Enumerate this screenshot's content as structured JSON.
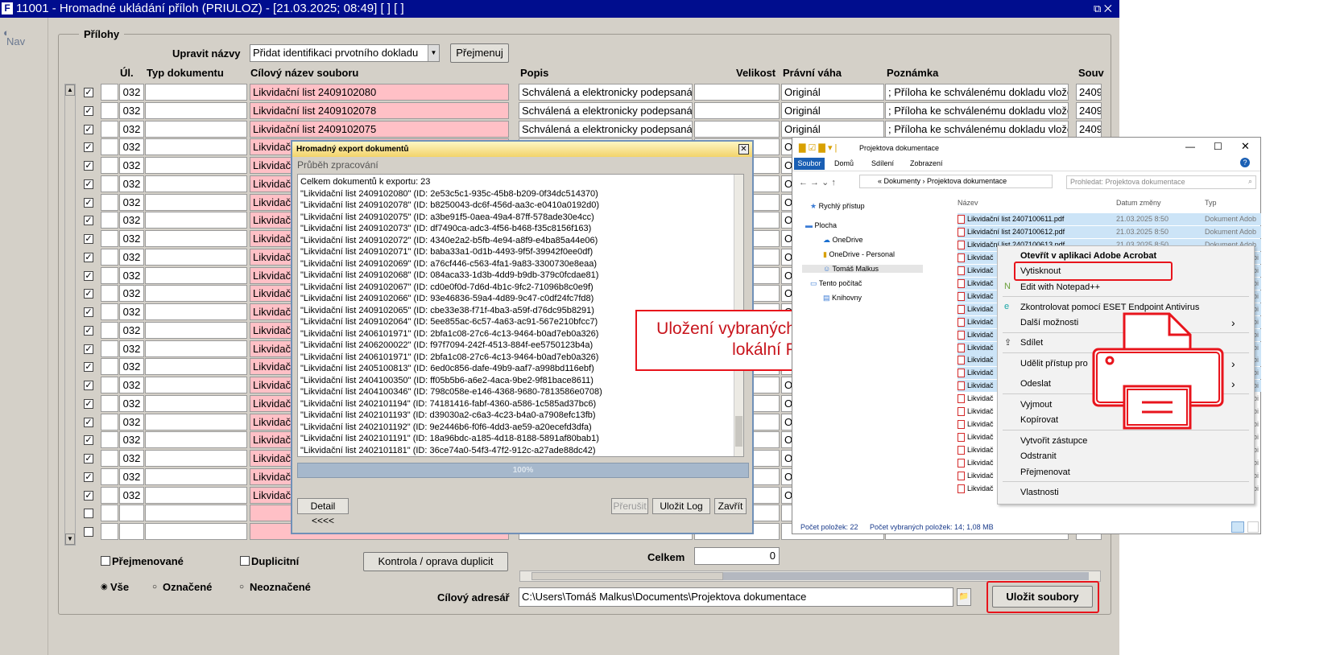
{
  "window": {
    "title": "11001 - Hromadné ukládání příloh (PRIULOZ) - [21.03.2025; 08:49]  [ ]  [ ]",
    "controls": "⧉ ✕"
  },
  "nav": {
    "label": "Nav"
  },
  "prilohy": {
    "legend": "Přílohy",
    "rename_label": "Upravit názvy",
    "rename_value": "Přidat identifikaci prvotního dokladu",
    "rename_button": "Přejmenuj",
    "columns": [
      "Úl.",
      "Typ dokumentu",
      "Cílový název souboru",
      "Popis",
      "Velikost",
      "Právní váha",
      "Poznámka",
      "Souv"
    ],
    "rows": [
      {
        "checked": true,
        "ul": "032",
        "name": "Likvidační list 2409102080",
        "popis": "Schválená a elektronicky podepsaná l",
        "vaha": "Originál",
        "pozn": "; Příloha ke schválenému dokladu vlože",
        "souv": "2409"
      },
      {
        "checked": true,
        "ul": "032",
        "name": "Likvidační list 2409102078",
        "popis": "Schválená a elektronicky podepsaná l",
        "vaha": "Originál",
        "pozn": "; Příloha ke schválenému dokladu vlože",
        "souv": "2409"
      },
      {
        "checked": true,
        "ul": "032",
        "name": "Likvidační list 2409102075",
        "popis": "Schválená a elektronicky podepsaná l",
        "vaha": "Originál",
        "pozn": "; Příloha ke schválenému dokladu vlože",
        "souv": "2409"
      },
      {
        "checked": true,
        "ul": "032",
        "name": "Likvidačn",
        "popis": "",
        "vaha": "O",
        "pozn": "",
        "souv": ""
      },
      {
        "checked": true,
        "ul": "032",
        "name": "Likvidačn",
        "popis": "",
        "vaha": "O",
        "pozn": "",
        "souv": ""
      },
      {
        "checked": true,
        "ul": "032",
        "name": "Likvidačn",
        "popis": "",
        "vaha": "O",
        "pozn": "",
        "souv": ""
      },
      {
        "checked": true,
        "ul": "032",
        "name": "Likvidačn",
        "popis": "",
        "vaha": "O",
        "pozn": "",
        "souv": ""
      },
      {
        "checked": true,
        "ul": "032",
        "name": "Likvidačn",
        "popis": "",
        "vaha": "O",
        "pozn": "",
        "souv": ""
      },
      {
        "checked": true,
        "ul": "032",
        "name": "Likvidačn",
        "popis": "",
        "vaha": "O",
        "pozn": "",
        "souv": ""
      },
      {
        "checked": true,
        "ul": "032",
        "name": "Likvidačn",
        "popis": "",
        "vaha": "O",
        "pozn": "",
        "souv": ""
      },
      {
        "checked": true,
        "ul": "032",
        "name": "Likvidačn",
        "popis": "",
        "vaha": "O",
        "pozn": "",
        "souv": ""
      },
      {
        "checked": true,
        "ul": "032",
        "name": "Likvidačn",
        "popis": "",
        "vaha": "O",
        "pozn": "",
        "souv": ""
      },
      {
        "checked": true,
        "ul": "032",
        "name": "Likvidačn",
        "popis": "",
        "vaha": "O",
        "pozn": "",
        "souv": ""
      },
      {
        "checked": true,
        "ul": "032",
        "name": "Likvidačn",
        "popis": "",
        "vaha": "O",
        "pozn": "",
        "souv": ""
      },
      {
        "checked": true,
        "ul": "032",
        "name": "Likvidačn",
        "popis": "",
        "vaha": "O",
        "pozn": "",
        "souv": ""
      },
      {
        "checked": true,
        "ul": "032",
        "name": "Likvidačn",
        "popis": "",
        "vaha": "O",
        "pozn": "",
        "souv": ""
      },
      {
        "checked": true,
        "ul": "032",
        "name": "Likvidačn",
        "popis": "",
        "vaha": "O",
        "pozn": "",
        "souv": ""
      },
      {
        "checked": true,
        "ul": "032",
        "name": "Likvidačn",
        "popis": "",
        "vaha": "O",
        "pozn": "",
        "souv": ""
      },
      {
        "checked": true,
        "ul": "032",
        "name": "Likvidačn",
        "popis": "",
        "vaha": "O",
        "pozn": "",
        "souv": ""
      },
      {
        "checked": true,
        "ul": "032",
        "name": "Likvidačn",
        "popis": "",
        "vaha": "O",
        "pozn": "",
        "souv": ""
      },
      {
        "checked": true,
        "ul": "032",
        "name": "Likvidačn",
        "popis": "",
        "vaha": "O",
        "pozn": "",
        "souv": ""
      },
      {
        "checked": true,
        "ul": "032",
        "name": "Likvidačn",
        "popis": "",
        "vaha": "O",
        "pozn": "",
        "souv": ""
      },
      {
        "checked": true,
        "ul": "032",
        "name": "Likvidačn",
        "popis": "",
        "vaha": "O",
        "pozn": "",
        "souv": ""
      },
      {
        "checked": false,
        "ul": "",
        "name": "",
        "popis": "",
        "vaha": "",
        "pozn": "",
        "souv": ""
      },
      {
        "checked": false,
        "ul": "",
        "name": "",
        "popis": "",
        "vaha": "",
        "pozn": "",
        "souv": ""
      }
    ],
    "filters": {
      "renamed": "Přejmenované",
      "duplicate": "Duplicitní",
      "check_button": "Kontrola / oprava duplicit",
      "all": "Vše",
      "marked": "Označené",
      "unmarked": "Neoznačené"
    },
    "total_label": "Celkem",
    "total_value": "0",
    "target_label": "Cílový adresář",
    "target_value": "C:\\Users\\Tomáš Malkus\\Documents\\Projektova dokumentace",
    "save_button": "Uložit soubory"
  },
  "dialog": {
    "title": "Hromadný export dokumentů",
    "subtitle": "Průběh zpracování",
    "close": "✕",
    "log": [
      "Celkem dokumentů k exportu: 23",
      "\"Likvidační list 2409102080\" (ID: 2e53c5c1-935c-45b8-b209-0f34dc514370)",
      "\"Likvidační list 2409102078\" (ID: b8250043-dc6f-456d-aa3c-e0410a0192d0)",
      "\"Likvidační list 2409102075\" (ID: a3be91f5-0aea-49a4-87ff-578ade30e4cc)",
      "\"Likvidační list 2409102073\" (ID: df7490ca-adc3-4f56-b468-f35c8156f163)",
      "\"Likvidační list 2409102072\" (ID: 4340e2a2-b5fb-4e94-a8f9-e4ba85a44e06)",
      "\"Likvidační list 2409102071\" (ID: baba33a1-0d1b-4493-9f5f-39942f0ee0df)",
      "\"Likvidační list 2409102069\" (ID: a76cf446-c563-4fa1-9a83-3300730e8eaa)",
      "\"Likvidační list 2409102068\" (ID: 084aca33-1d3b-4dd9-b9db-379c0fcdae81)",
      "\"Likvidační list 2409102067\" (ID: cd0e0f0d-7d6d-4b1c-9fc2-71096b8c0e9f)",
      "\"Likvidační list 2409102066\" (ID: 93e46836-59a4-4d89-9c47-c0df24fc7fd8)",
      "\"Likvidační list 2409102065\" (ID: cbe33e38-f71f-4ba3-a59f-d76dc95b8291)",
      "\"Likvidační list 2409102064\" (ID: 5ee855ac-6c57-4a63-ac91-567e210bfcc7)",
      "\"Likvidační list 2406101971\" (ID: 2bfa1c08-27c6-4c13-9464-b0ad7eb0a326)",
      "\"Likvidační list 2406200022\" (ID: f97f7094-242f-4513-884f-ee5750123b4a)",
      "\"Likvidační list 2406101971\" (ID: 2bfa1c08-27c6-4c13-9464-b0ad7eb0a326)",
      "\"Likvidační list 2405100813\" (ID: 6ed0c856-dafe-49b9-aaf7-a998bd116ebf)",
      "\"Likvidační list 2404100350\" (ID: ff05b5b6-a6e2-4aca-9be2-9f81bace8611)",
      "\"Likvidační list 2404100346\" (ID: 798c058e-e146-4368-9680-7813586e0708)",
      "\"Likvidační list 2402101194\" (ID: 74181416-fabf-4360-a586-1c585ad37bc6)",
      "\"Likvidační list 2402101193\" (ID: d39030a2-c6a3-4c23-b4a0-a7908efc13fb)",
      "\"Likvidační list 2402101192\" (ID: 9e2446b6-f0f6-4dd3-ae59-a20ecefd3dfa)",
      "\"Likvidační list 2402101191\" (ID: 18a96bdc-a185-4d18-8188-5891af80bab1)",
      "\"Likvidační list 2402101181\" (ID: 36ce74a0-54f3-47f2-912c-a27ade88dc42)"
    ],
    "progress": 1.0,
    "progress_label": "100%",
    "detail_button": "Detail <<<<",
    "interrupt_button": "Přerušit",
    "save_log_button": "Uložit Log",
    "close_button": "Zavřít"
  },
  "callout": {
    "text_line1": "Uložení vybraných souborů na",
    "text_line2": "lokální PC",
    "color": "#e8141c"
  },
  "explorer": {
    "title": "Projektova dokumentace",
    "ribbon_tabs": [
      "Soubor",
      "Domů",
      "Sdílení",
      "Zobrazení"
    ],
    "breadcrumb": [
      "Dokumenty",
      "Projektova dokumentace"
    ],
    "search_placeholder": "Prohledat: Projektova dokumentace",
    "nav_items": [
      "Rychlý přístup",
      "Plocha",
      "OneDrive",
      "OneDrive - Personal",
      "Tomáš Malkus",
      "Tento počítač",
      "Knihovny"
    ],
    "columns": [
      "Název",
      "Datum změny",
      "Typ"
    ],
    "files": [
      {
        "name": "Likvidační list 2407100611.pdf",
        "date": "21.03.2025 8:50",
        "type": "Dokument Adob"
      },
      {
        "name": "Likvidační list 2407100612.pdf",
        "date": "21.03.2025 8:50",
        "type": "Dokument Adob"
      },
      {
        "name": "Likvidační list 2407100613.pdf",
        "date": "21.03.2025 8:50",
        "type": "Dokument Adob"
      },
      {
        "name": "Likvidač",
        "date": "",
        "type": "obi"
      },
      {
        "name": "Likvidač",
        "date": "",
        "type": "obi"
      },
      {
        "name": "Likvidač",
        "date": "",
        "type": "obi"
      },
      {
        "name": "Likvidač",
        "date": "",
        "type": "obi"
      },
      {
        "name": "Likvidač",
        "date": "",
        "type": "obi"
      },
      {
        "name": "Likvidač",
        "date": "",
        "type": "obi"
      },
      {
        "name": "Likvidač",
        "date": "",
        "type": "obi"
      },
      {
        "name": "Likvidač",
        "date": "",
        "type": "obi"
      },
      {
        "name": "Likvidač",
        "date": "",
        "type": "obi"
      },
      {
        "name": "Likvidač",
        "date": "",
        "type": "obi"
      },
      {
        "name": "Likvidač",
        "date": "",
        "type": "obi"
      },
      {
        "name": "Likvidač",
        "date": "",
        "type": "obi"
      },
      {
        "name": "Likvidač",
        "date": "",
        "type": "obi"
      },
      {
        "name": "Likvidač",
        "date": "",
        "type": "obi"
      },
      {
        "name": "Likvidač",
        "date": "",
        "type": "obi"
      },
      {
        "name": "Likvidač",
        "date": "",
        "type": "obi"
      },
      {
        "name": "Likvidač",
        "date": "",
        "type": "obi"
      },
      {
        "name": "Likvidač",
        "date": "",
        "type": "obi"
      },
      {
        "name": "Likvidač",
        "date": "",
        "type": "obi"
      }
    ],
    "selected_count": 14,
    "status_count": "Počet položek: 22",
    "status_selected": "Počet vybraných položek: 14; 1,08 MB"
  },
  "context_menu": {
    "items": [
      "Otevřít v aplikaci Adobe Acrobat",
      "Vytisknout",
      "Edit with Notepad++",
      "Zkontrolovat pomocí ESET Endpoint Antivirus",
      "Další možnosti",
      "Sdílet",
      "Udělit přístup pro",
      "Odeslat",
      "Vyjmout",
      "Kopírovat",
      "Vytvořit zástupce",
      "Odstranit",
      "Přejmenovat",
      "Vlastnosti"
    ]
  }
}
